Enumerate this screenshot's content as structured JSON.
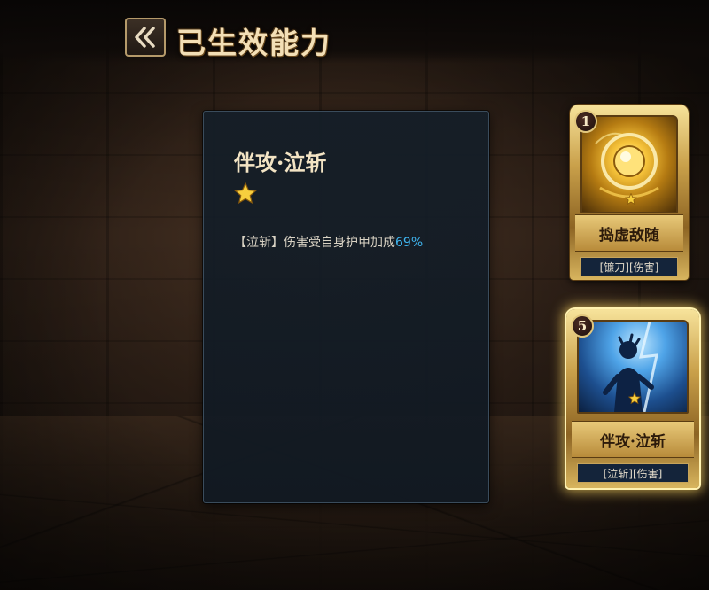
{
  "header": {
    "back_icon": "double-chevron-left-icon",
    "title": "已生效能力"
  },
  "detail": {
    "name": "伴攻·泣斩",
    "star_count": 1,
    "desc_prefix": "【泣斩】伤害受自身护甲加成",
    "desc_value": "69%",
    "highlight_color": "#3fb4ee"
  },
  "cards": [
    {
      "cost": "1",
      "name": "捣虚敌随",
      "tags": "[镰刀][伤害]",
      "art_icon": "golden-shield-orb-icon",
      "selected": false
    },
    {
      "cost": "5",
      "name": "伴攻·泣斩",
      "tags": "[泣斩][伤害]",
      "art_icon": "warrior-silhouette-icon",
      "selected": true
    }
  ]
}
